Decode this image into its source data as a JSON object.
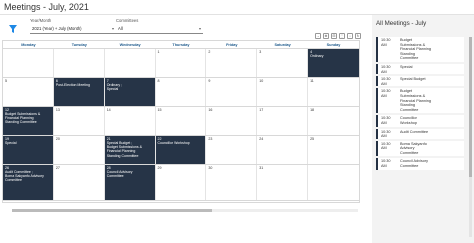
{
  "page": {
    "title": "Meetings - July, 2021"
  },
  "filters": {
    "year_month": {
      "label": "Year/Month",
      "value": "2021 (Year) + July (Month)"
    },
    "committees": {
      "label": "Committees",
      "value": "All"
    }
  },
  "toolbar": {
    "buttons": [
      "→",
      "⊕",
      "⊟",
      "⋮",
      "↓",
      "↻"
    ]
  },
  "calendar": {
    "days_of_week": [
      "Monday",
      "Tuesday",
      "Wednesday",
      "Thursday",
      "Friday",
      "Saturday",
      "Sunday"
    ],
    "weeks": [
      [
        {
          "num": "",
          "event": null
        },
        {
          "num": "",
          "event": null
        },
        {
          "num": "",
          "event": null
        },
        {
          "num": "1",
          "event": null
        },
        {
          "num": "2",
          "event": null
        },
        {
          "num": "3",
          "event": null
        },
        {
          "num": "4",
          "event": [
            "Ordinary"
          ]
        }
      ],
      [
        {
          "num": "5",
          "event": null
        },
        {
          "num": "6",
          "event": [
            "Post-Election Meeting"
          ]
        },
        {
          "num": "7",
          "event": [
            "Ordinary ;",
            "Special"
          ]
        },
        {
          "num": "8",
          "event": null
        },
        {
          "num": "9",
          "event": null
        },
        {
          "num": "10",
          "event": null
        },
        {
          "num": "11",
          "event": null
        }
      ],
      [
        {
          "num": "12",
          "event": [
            "Budget Submissions &",
            "Financial Planning",
            "Standing Committee"
          ]
        },
        {
          "num": "13",
          "event": null
        },
        {
          "num": "14",
          "event": null
        },
        {
          "num": "15",
          "event": null
        },
        {
          "num": "16",
          "event": null
        },
        {
          "num": "17",
          "event": null
        },
        {
          "num": "18",
          "event": null
        }
      ],
      [
        {
          "num": "19",
          "event": [
            "Special"
          ]
        },
        {
          "num": "20",
          "event": null
        },
        {
          "num": "21",
          "event": [
            "Special Budget ;",
            "Budget Submissions &",
            "Financial Planning",
            "Standing Committee"
          ]
        },
        {
          "num": "22",
          "event": [
            "Councillor Workshop"
          ]
        },
        {
          "num": "23",
          "event": null
        },
        {
          "num": "24",
          "event": null
        },
        {
          "num": "25",
          "event": null
        }
      ],
      [
        {
          "num": "26",
          "event": [
            "Audit Committee ;",
            "Boma Sakyanfo Advisory",
            "Committee"
          ]
        },
        {
          "num": "27",
          "event": null
        },
        {
          "num": "28",
          "event": [
            "Council Advisory",
            "Committee"
          ]
        },
        {
          "num": "29",
          "event": null
        },
        {
          "num": "30",
          "event": null
        },
        {
          "num": "31",
          "event": null
        },
        {
          "num": "",
          "event": null
        }
      ]
    ]
  },
  "agenda": {
    "title": "All Meetings - July",
    "items": [
      {
        "time": [
          "10:30",
          "AM"
        ],
        "name": [
          "Budget",
          "Submissions &",
          "Financial Planning",
          "Standing",
          "Committee"
        ]
      },
      {
        "time": [
          "10:30",
          "AM"
        ],
        "name": [
          "Special"
        ]
      },
      {
        "time": [
          "10:30",
          "AM"
        ],
        "name": [
          "Special Budget"
        ]
      },
      {
        "time": [
          "10:30",
          "AM"
        ],
        "name": [
          "Budget",
          "Submissions &",
          "Financial Planning",
          "Standing",
          "Committee"
        ]
      },
      {
        "time": [
          "10:30",
          "AM"
        ],
        "name": [
          "Councillor",
          "Workshop"
        ]
      },
      {
        "time": [
          "10:30",
          "AM"
        ],
        "name": [
          "Audit Committee"
        ]
      },
      {
        "time": [
          "10:30",
          "AM"
        ],
        "name": [
          "Boma Sakyanfo",
          "Advisory",
          "Committee"
        ]
      },
      {
        "time": [
          "10:30",
          "AM"
        ],
        "name": [
          "Council Advisory",
          "Committee"
        ]
      }
    ]
  },
  "colors": {
    "event_bg": "#243143",
    "day_header": "#1e5a8c",
    "accent": "#1e88e5"
  }
}
